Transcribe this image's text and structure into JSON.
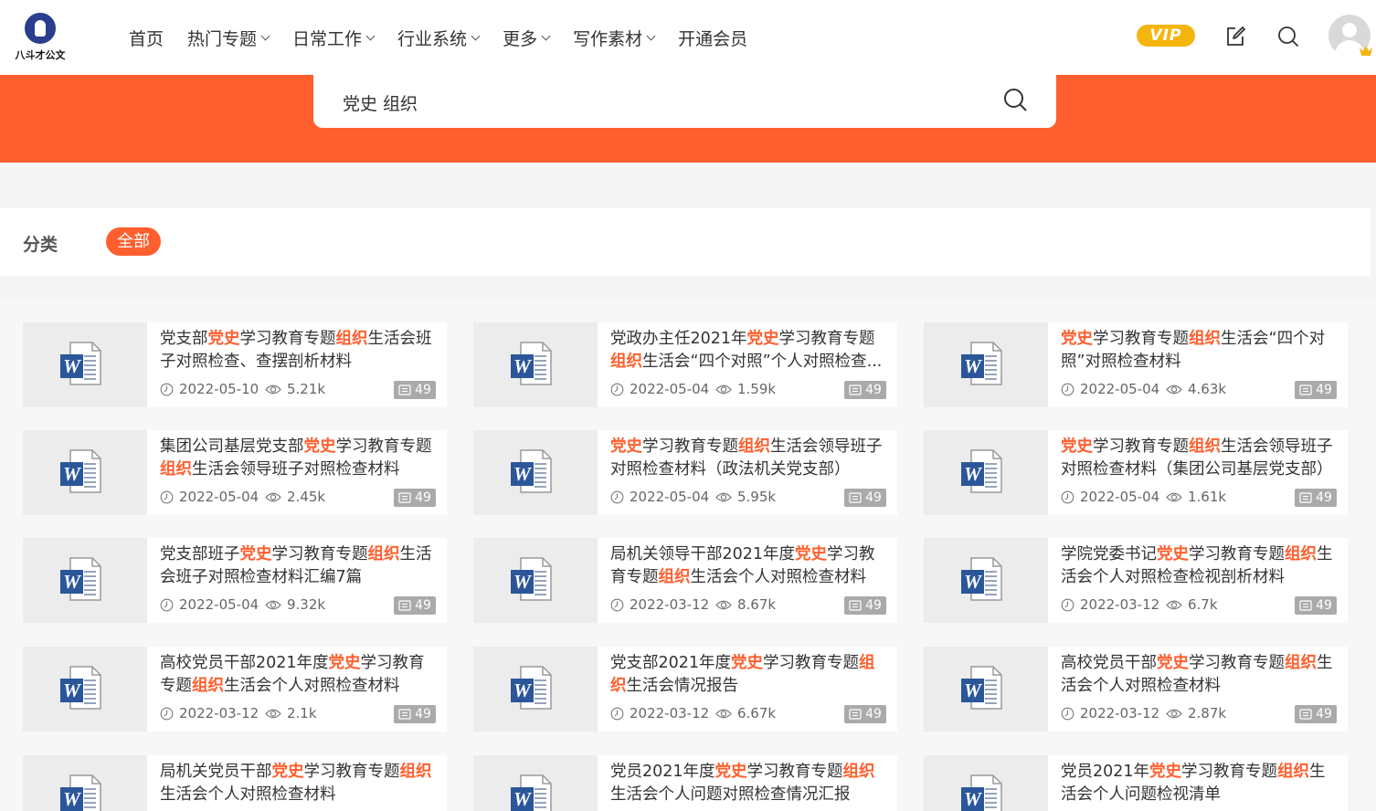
{
  "header": {
    "logo_text": "八斗才公文",
    "nav": [
      {
        "label": "首页",
        "dropdown": false
      },
      {
        "label": "热门专题",
        "dropdown": true
      },
      {
        "label": "日常工作",
        "dropdown": true
      },
      {
        "label": "行业系统",
        "dropdown": true
      },
      {
        "label": "更多",
        "dropdown": true
      },
      {
        "label": "写作素材",
        "dropdown": true
      },
      {
        "label": "开通会员",
        "dropdown": false
      }
    ],
    "vip_label": "VIP",
    "icons": [
      "edit-icon",
      "search-icon",
      "avatar",
      "crown-icon"
    ]
  },
  "search": {
    "value": "党史 组织"
  },
  "category": {
    "label": "分类",
    "selected": "全部"
  },
  "highlight_terms": [
    "党史",
    "组织"
  ],
  "colors": {
    "accent": "#ff5f2e",
    "vip": "#f5b50f",
    "word_blue": "#2b579a"
  },
  "results": [
    {
      "title": "党支部党史学习教育专题组织生活会班子对照检查、查摆剖析材料",
      "date": "2022-05-10",
      "views": "5.21k",
      "pages": "49"
    },
    {
      "title": "党政办主任2021年党史学习教育专题组织生活会“四个对照”个人对照检查...",
      "date": "2022-05-04",
      "views": "1.59k",
      "pages": "49"
    },
    {
      "title": "党史学习教育专题组织生活会“四个对照”对照检查材料",
      "date": "2022-05-04",
      "views": "4.63k",
      "pages": "49"
    },
    {
      "title": "集团公司基层党支部党史学习教育专题组织生活会领导班子对照检查材料",
      "date": "2022-05-04",
      "views": "2.45k",
      "pages": "49"
    },
    {
      "title": "党史学习教育专题组织生活会领导班子对照检查材料（政法机关党支部）",
      "date": "2022-05-04",
      "views": "5.95k",
      "pages": "49"
    },
    {
      "title": "党史学习教育专题组织生活会领导班子对照检查材料（集团公司基层党支部）",
      "date": "2022-05-04",
      "views": "1.61k",
      "pages": "49"
    },
    {
      "title": "党支部班子党史学习教育专题组织生活会班子对照检查材料汇编7篇",
      "date": "2022-05-04",
      "views": "9.32k",
      "pages": "49"
    },
    {
      "title": "局机关领导干部2021年度党史学习教育专题组织生活会个人对照检查材料",
      "date": "2022-03-12",
      "views": "8.67k",
      "pages": "49"
    },
    {
      "title": "学院党委书记党史学习教育专题组织生活会个人对照检查检视剖析材料",
      "date": "2022-03-12",
      "views": "6.7k",
      "pages": "49"
    },
    {
      "title": "高校党员干部2021年度党史学习教育专题组织生活会个人对照检查材料",
      "date": "2022-03-12",
      "views": "2.1k",
      "pages": "49"
    },
    {
      "title": "党支部2021年度党史学习教育专题组织生活会情况报告",
      "date": "2022-03-12",
      "views": "6.67k",
      "pages": "49"
    },
    {
      "title": "高校党员干部党史学习教育专题组织生活会个人对照检查材料",
      "date": "2022-03-12",
      "views": "2.87k",
      "pages": "49"
    },
    {
      "title": "局机关党员干部党史学习教育专题组织生活会个人对照检查材料",
      "date": "",
      "views": "",
      "pages": ""
    },
    {
      "title": "党员2021年度党史学习教育专题组织生活会个人问题对照检查情况汇报",
      "date": "",
      "views": "",
      "pages": ""
    },
    {
      "title": "党员2021年党史学习教育专题组织生活会个人问题检视清单",
      "date": "",
      "views": "",
      "pages": ""
    }
  ]
}
